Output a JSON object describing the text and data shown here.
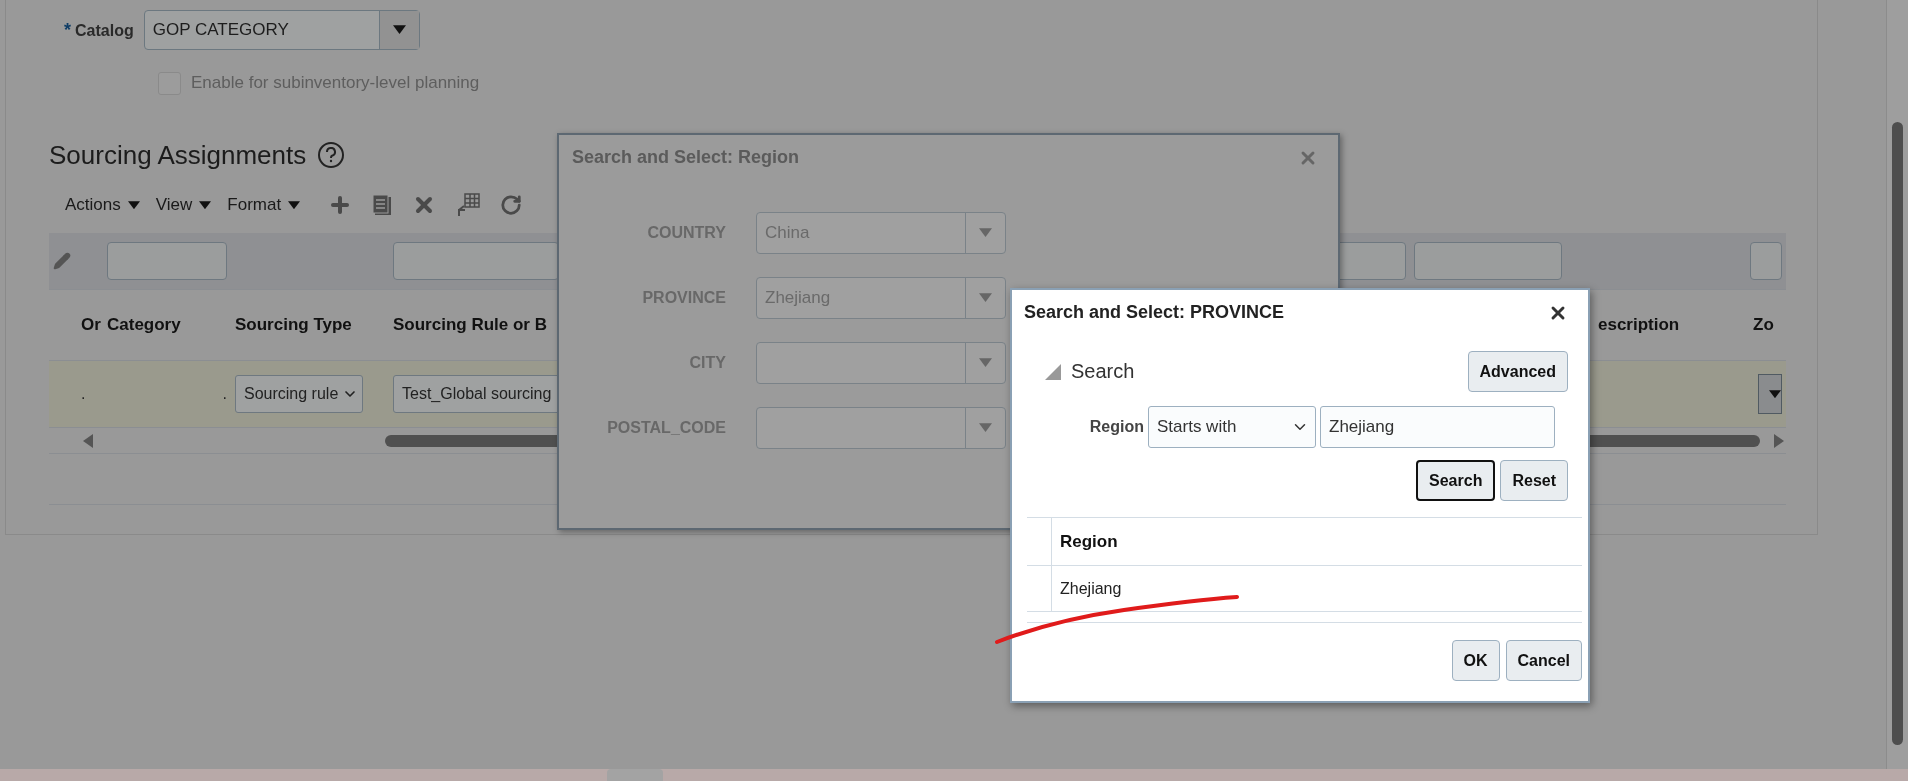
{
  "catalog": {
    "label": "Catalog",
    "required_mark": "*",
    "value": "GOP CATEGORY"
  },
  "subinventory_option": {
    "label": "Enable for subinventory-level planning",
    "checked": false
  },
  "section_title": "Sourcing Assignments",
  "toolbar_menus": [
    "Actions",
    "View",
    "Format"
  ],
  "table": {
    "columns": [
      {
        "label": "Or",
        "filter": false
      },
      {
        "label": "Category",
        "filter": true
      },
      {
        "label": "Sourcing Type",
        "filter": false
      },
      {
        "label": "Sourcing Rule or B",
        "filter": true
      },
      {
        "filter": true
      },
      {
        "filter": true
      },
      {
        "label": "escription",
        "filter": false
      },
      {
        "label": "Zo",
        "filter": true
      }
    ],
    "rows": [
      {
        "cells": [
          {
            "kind": "text",
            "value": "."
          },
          {
            "kind": "text",
            "value": "."
          },
          {
            "kind": "select",
            "value": "Sourcing rule"
          },
          {
            "kind": "input",
            "value": "Test_Global sourcing"
          },
          null,
          null,
          null,
          {
            "kind": "dropdown"
          }
        ]
      }
    ]
  },
  "region_dialog": {
    "title": "Search and Select: Region",
    "fields": [
      {
        "label": "COUNTRY",
        "value": "China"
      },
      {
        "label": "PROVINCE",
        "value": "Zhejiang"
      },
      {
        "label": "CITY"
      },
      {
        "label": "POSTAL_CODE"
      }
    ]
  },
  "province_dialog": {
    "title": "Search and Select: PROVINCE",
    "search_header": {
      "label": "Search",
      "expanded": true
    },
    "advanced_button": "Advanced",
    "criteria": {
      "label": "Region",
      "operator": "Starts with",
      "value": "Zhejiang"
    },
    "search_button": "Search",
    "reset_button": "Reset",
    "results": {
      "columns": [
        "Region"
      ],
      "rows": [
        [
          "Zhejiang"
        ]
      ]
    },
    "buttons": [
      "OK",
      "Cancel"
    ]
  }
}
